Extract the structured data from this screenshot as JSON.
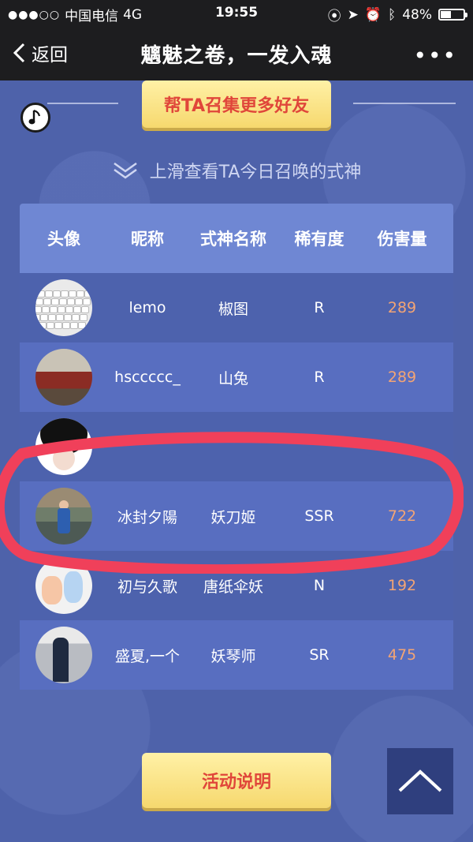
{
  "status": {
    "carrier": "中国电信",
    "network": "4G",
    "time": "19:55",
    "battery": "48%",
    "battery_level": 0.48
  },
  "nav": {
    "back_label": "返回",
    "title": "魑魅之卷，一发入魂"
  },
  "invite_label": "帮TA召集更多好友",
  "hint": "上滑查看TA今日召唤的式神",
  "table": {
    "headers": [
      "头像",
      "昵称",
      "式神名称",
      "稀有度",
      "伤害量"
    ],
    "rows": [
      {
        "nick": "lemo",
        "shikigami": "椒图",
        "rarity": "R",
        "damage": "289",
        "avatar_icon": "keyboard-photo"
      },
      {
        "nick": "hsccccc_",
        "shikigami": "山兔",
        "rarity": "R",
        "damage": "289",
        "avatar_icon": "street-photo"
      },
      {
        "nick": "",
        "shikigami": "",
        "rarity": "",
        "damage": "",
        "avatar_icon": "girl-photo"
      },
      {
        "nick": "冰封夕陽",
        "shikigami": "妖刀姬",
        "rarity": "SSR",
        "damage": "722",
        "avatar_icon": "man-photo"
      },
      {
        "nick": "初与久歌",
        "shikigami": "唐纸伞妖",
        "rarity": "N",
        "damage": "192",
        "avatar_icon": "toy-photo"
      },
      {
        "nick": "盛夏,一个",
        "shikigami": "妖琴师",
        "rarity": "SR",
        "damage": "475",
        "avatar_icon": "person-photo"
      }
    ]
  },
  "rules_label": "活动说明",
  "colors": {
    "accent_red": "#e0463a",
    "damage": "#f3a474",
    "header_row": "#6f87d3",
    "highlight_circle": "#f0405a"
  }
}
